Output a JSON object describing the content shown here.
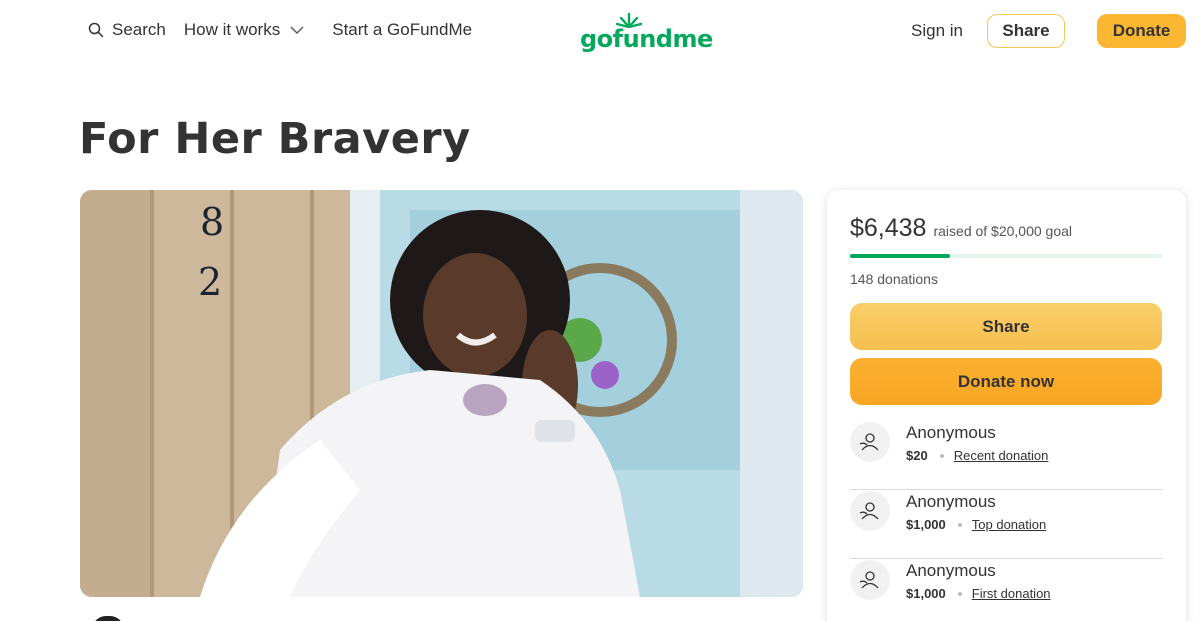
{
  "nav": {
    "search_label": "Search",
    "how_it_works_label": "How it works",
    "start_label": "Start a GoFundMe",
    "logo_text": "gofundme",
    "signin_label": "Sign in",
    "share_label": "Share",
    "donate_label": "Donate"
  },
  "campaign": {
    "title": "For Her Bravery"
  },
  "fundraiser": {
    "raised_amount": "$6,438",
    "raised_of_goal": "raised of $20,000 goal",
    "progress_fraction": 0.32,
    "donations_count": "148 donations",
    "share_button": "Share",
    "donate_button": "Donate now"
  },
  "donations": [
    {
      "name": "Anonymous",
      "amount": "$20",
      "type": "Recent donation"
    },
    {
      "name": "Anonymous",
      "amount": "$1,000",
      "type": "Top donation"
    },
    {
      "name": "Anonymous",
      "amount": "$1,000",
      "type": "First donation"
    }
  ],
  "colors": {
    "brand_green": "#02a95c",
    "donate_orange": "#fbb030",
    "share_yellow": "#f9cf6a"
  },
  "icons": {
    "search": "search-icon",
    "chevron": "chevron-down-icon",
    "avatar": "donor-avatar-icon",
    "logo_sprout": "sprout-icon"
  }
}
